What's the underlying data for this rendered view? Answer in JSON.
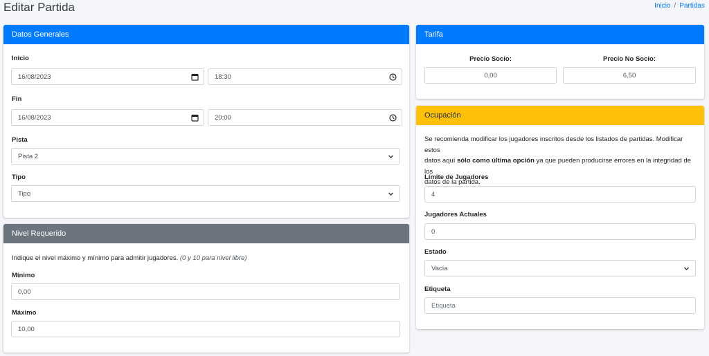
{
  "page": {
    "title": "Editar Partida"
  },
  "breadcrumb": {
    "items": [
      "Inicio",
      "Partidas"
    ],
    "separator": "/"
  },
  "datos_generales": {
    "header": "Datos Generales",
    "inicio": {
      "label": "Inicio",
      "date": "16/08/2023",
      "time": "18:30"
    },
    "fin": {
      "label": "Fin",
      "date": "16/08/2023",
      "time": "20:00"
    },
    "pista": {
      "label": "Pista",
      "value": "Pista 2"
    },
    "tipo": {
      "label": "Tipo",
      "value": "Tipo"
    }
  },
  "nivel": {
    "header": "Nivel Requerido",
    "description": "Indique el nivel máximo y mínimo para admitir jugadores.",
    "hint": "(0 y 10 para nivel libre)",
    "minimo": {
      "label": "Mínimo",
      "value": "0,00"
    },
    "maximo": {
      "label": "Máximo",
      "value": "10,00"
    }
  },
  "tarifa": {
    "header": "Tarifa",
    "socio": {
      "label": "Precio Socio:",
      "value": "0,00"
    },
    "no_socio": {
      "label": "Precio No Socio:",
      "value": "6,50"
    }
  },
  "ocupacion": {
    "header": "Ocupación",
    "desc_1": "Se recomienda modificar los jugadores inscritos desde los listados de partidas. Modificar estos",
    "desc_2a": "datos aquí ",
    "desc_2b": "sólo como última opción",
    "desc_2c": " ya que pueden producirse errores en la integridad de los",
    "desc_3": "datos de la partida.",
    "limite": {
      "label": "Límite de Jugadores",
      "value": "4"
    },
    "actuales": {
      "label": "Jugadores Actuales",
      "value": "0"
    },
    "estado": {
      "label": "Estado",
      "value": "Vacía"
    },
    "etiqueta": {
      "label": "Etiqueta",
      "placeholder": "Etiqueta"
    }
  },
  "colors": {
    "primary": "#007bff",
    "secondary": "#6c757d",
    "warning": "#ffc107",
    "background": "#f4f6f9"
  },
  "icons": {
    "date": "calendar-icon",
    "time": "clock-icon",
    "select": "chevron-down-icon"
  }
}
